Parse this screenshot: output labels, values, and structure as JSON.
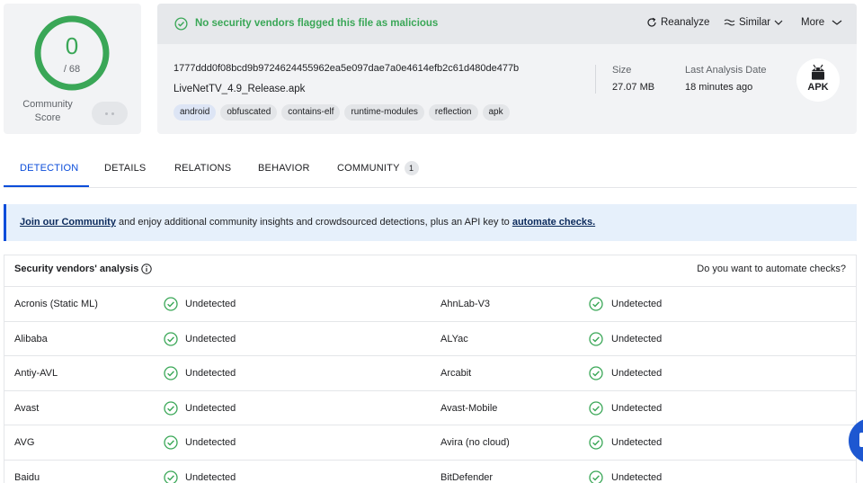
{
  "score": {
    "detected": "0",
    "total": "/ 68",
    "community_label_1": "Community",
    "community_label_2": "Score",
    "ring_color": "#3aa757"
  },
  "banner": {
    "message": "No security vendors flagged this file as malicious",
    "reanalyze": "Reanalyze",
    "similar": "Similar",
    "more": "More"
  },
  "file": {
    "hash": "1777ddd0f08bcd9b9724624455962ea5e097dae7a0e4614efb2c61d480de477b",
    "name": "LiveNetTV_4.9_Release.apk",
    "tags": [
      "android",
      "obfuscated",
      "contains-elf",
      "runtime-modules",
      "reflection",
      "apk"
    ],
    "size_label": "Size",
    "size_value": "27.07 MB",
    "last_analysis_label": "Last Analysis Date",
    "last_analysis_value": "18 minutes ago",
    "type_badge": "APK"
  },
  "tabs": [
    {
      "label": "DETECTION"
    },
    {
      "label": "DETAILS"
    },
    {
      "label": "RELATIONS"
    },
    {
      "label": "BEHAVIOR"
    },
    {
      "label": "COMMUNITY",
      "count": "1"
    }
  ],
  "join": {
    "link1": "Join our Community",
    "middle": " and enjoy additional community insights and crowdsourced detections, plus an API key to ",
    "link2": "automate checks."
  },
  "vendors": {
    "title": "Security vendors' analysis",
    "automate_question": "Do you want to automate checks?",
    "rows": [
      {
        "left_name": "Acronis (Static ML)",
        "left_status": "Undetected",
        "right_name": "AhnLab-V3",
        "right_status": "Undetected"
      },
      {
        "left_name": "Alibaba",
        "left_status": "Undetected",
        "right_name": "ALYac",
        "right_status": "Undetected"
      },
      {
        "left_name": "Antiy-AVL",
        "left_status": "Undetected",
        "right_name": "Arcabit",
        "right_status": "Undetected"
      },
      {
        "left_name": "Avast",
        "left_status": "Undetected",
        "right_name": "Avast-Mobile",
        "right_status": "Undetected"
      },
      {
        "left_name": "AVG",
        "left_status": "Undetected",
        "right_name": "Avira (no cloud)",
        "right_status": "Undetected"
      },
      {
        "left_name": "Baidu",
        "left_status": "Undetected",
        "right_name": "BitDefender",
        "right_status": "Undetected"
      }
    ]
  },
  "colors": {
    "accent": "#0b4dda",
    "clean": "#3aa757"
  }
}
